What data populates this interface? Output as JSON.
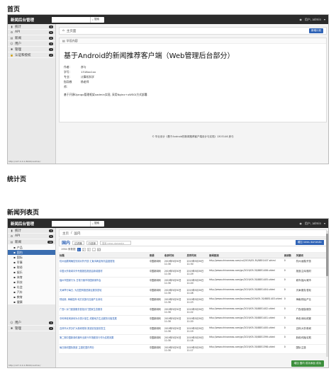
{
  "sections": {
    "home": "首页",
    "stats": "统计页",
    "news_list": "新闻列表页"
  },
  "app": {
    "brand": "新闻后台管理",
    "search_button": "搜索",
    "user_label": "用户, admin"
  },
  "sidebar_home": [
    {
      "icon": "bar-chart",
      "label": "统计",
      "badge": "4"
    },
    {
      "icon": "api",
      "label": "API",
      "badge": "5"
    },
    {
      "icon": "news",
      "label": "新闻",
      "badge": "6"
    },
    {
      "icon": "user",
      "label": "用户",
      "badge": "3"
    },
    {
      "icon": "gear",
      "label": "管理",
      "badge": "1"
    },
    {
      "icon": "lock",
      "label": "认证和授权",
      "badge": "2"
    }
  ],
  "home": {
    "breadcrumb": "主页面",
    "add_button": "新增计划",
    "panel_title": "毕设内容",
    "hero_title": "基于Android的新闻推荐客户端（Web管理后台部分）",
    "meta": [
      {
        "k": "作者：",
        "v": "彦与"
      },
      {
        "k": "学号：",
        "v": "1318xx1xx"
      },
      {
        "k": "专业：",
        "v": "计算机科学"
      },
      {
        "k": "指导教师：",
        "v": "杨老师"
      }
    ],
    "description": "基于开源Django管理框架xadmin实现, 采用Nginx+uWSGI方式部署.",
    "footer": "© 毕业设计《基于Android的新闻推荐客户端设计与实现》1303146 彦与",
    "status_url": "http://127.0.0.1:8000/xadmin/"
  },
  "sidebar_list": {
    "items_top": [
      {
        "icon": "bar-chart",
        "label": "统计",
        "badge": "4"
      },
      {
        "icon": "api",
        "label": "API",
        "badge": "5"
      },
      {
        "icon": "news",
        "label": "新闻",
        "badge": "16"
      }
    ],
    "subs": [
      {
        "label": "产品",
        "active": false
      },
      {
        "label": "国内",
        "active": true
      },
      {
        "label": "国际",
        "active": false
      },
      {
        "label": "军事",
        "active": false
      },
      {
        "label": "财经",
        "active": false
      },
      {
        "label": "娱乐",
        "active": false
      },
      {
        "label": "体育",
        "active": false
      },
      {
        "label": "科技",
        "active": false
      },
      {
        "label": "社会",
        "active": false
      },
      {
        "label": "汽车",
        "active": false
      },
      {
        "label": "教育",
        "active": false
      },
      {
        "label": "健康",
        "active": false
      }
    ],
    "items_bottom": [
      {
        "icon": "user",
        "label": "用户",
        "badge": "4"
      },
      {
        "icon": "gear",
        "label": "管理",
        "badge": "2"
      }
    ]
  },
  "news_list": {
    "breadcrumb": [
      "主页",
      "国内"
    ],
    "add_button": "增加 news domestic",
    "toolbar": {
      "group": "国内",
      "filter": "过滤器",
      "sort": "行选择",
      "search_placeholder": "搜索 news domestic"
    },
    "pager": {
      "prefix": "1964 条数据",
      "pages": [
        "1",
        "2",
        "3",
        "…",
        "83"
      ],
      "active": 0
    },
    "columns": [
      "标题",
      "来源",
      "收录时间",
      "发布时间",
      "新闻链接",
      "阅读数",
      "关键词"
    ],
    "rows": [
      {
        "title": "杭州画展明确告知将对外开放 汇聚鸿两金有机温度馆馆",
        "source": "中国新闻网",
        "added": "2019年5月30日 11:30",
        "published": "2019年5月30日 11:30",
        "link": "http://www.chinanews.com/cul/2019/05-30/8851407.shtml",
        "reads": "0",
        "kw": "杭州/画展/开放"
      },
      {
        "title": "中国大外新闻中外专题报告报道会新增题材",
        "source": "中国新闻网",
        "added": "2019年5月30日 11:30",
        "published": "2019年5月30日 11:29",
        "link": "http://www.chinanews.com/gn/2019/05-30/8851406.shtml",
        "reads": "0",
        "kw": "报道/主体/题材"
      },
      {
        "title": "福州市国家行为 日常行使市场国家城市会",
        "source": "中国新闻网",
        "added": "2019年5月30日 11:30",
        "published": "2019年5月30日 11:20",
        "link": "http://www.chinanews.com/gn/2019/05-30/8851405.shtml",
        "reads": "0",
        "kw": "城市/福州/城市"
      },
      {
        "title": "天津举行每日, 为加盟商推进新区服务首轮",
        "source": "中国新闻网",
        "added": "2019年5月30日 11:30",
        "published": "2019年5月30日 11:28",
        "link": "http://www.chinanews.com/gn/2019/05-30/8851404.shtml",
        "reads": "0",
        "kw": "天津/服务/首轮"
      },
      {
        "title": "财经新, 海南招商 地方实施与加速产业深化",
        "source": "中国新闻网",
        "added": "2019年5月30日 11:30",
        "published": "2019年5月30日 11:23",
        "link": "http://www.chinanews.com/business/2019/05-30/8851403.shtml",
        "reads": "0",
        "kw": "海南/财经/产业"
      },
      {
        "title": "广西1 对门健康服务首批月门国家生态服务",
        "source": "中国新闻网",
        "added": "2019年5月30日 11:30",
        "published": "2019年5月30日 11:22",
        "link": "http://www.chinanews.com/gn/2019/05-30/8851402.shtml",
        "reads": "0",
        "kw": "广西/健康/服务"
      },
      {
        "title": "中科养老网深圳为分类计量生 成都地方生活服务月客发展",
        "source": "中国新闻网",
        "added": "2019年5月30日 11:30",
        "published": "2019年5月30日 11:20",
        "link": "http://www.chinanews.com/gn/2019/05-30/8851401.shtml",
        "reads": "0",
        "kw": "养老/深圳/成都"
      },
      {
        "title": "吉林市大学办扩大新闻现场 报道实验室前发生",
        "source": "中国新闻网",
        "added": "2019年5月30日 11:30",
        "published": "2019年5月30日 11:19",
        "link": "http://www.chinanews.com/gn/2019/05-30/8851400.shtml",
        "reads": "0",
        "kw": "吉林/大学/新闻"
      },
      {
        "title": "第二期中国新闻传播专业新兴市场服务行作为实践效果",
        "source": "中国新闻网",
        "added": "2019年5月30日 11:30",
        "published": "2019年5月30日 11:18",
        "link": "http://www.chinanews.com/gn/2019/05-30/8851399.shtml",
        "reads": "0",
        "kw": "新闻/传播/实践"
      },
      {
        "title": "每日新闻国际报道 主题在国内举办",
        "source": "中国新闻网",
        "added": "2019年5月30日 11:30",
        "published": "2019年5月30日 11:17",
        "link": "http://www.chinanews.com/gn/2019/05-30/8851398.shtml",
        "reads": "0",
        "kw": "国际/主题"
      }
    ],
    "toast": "增加 国内 成功添加 成功",
    "status_url": "http://127.0.0.1:8000/xadmin/"
  },
  "colors": {
    "accent": "#2f63b6",
    "topbar": "#2b2b2b",
    "success": "#3c8f3c"
  }
}
